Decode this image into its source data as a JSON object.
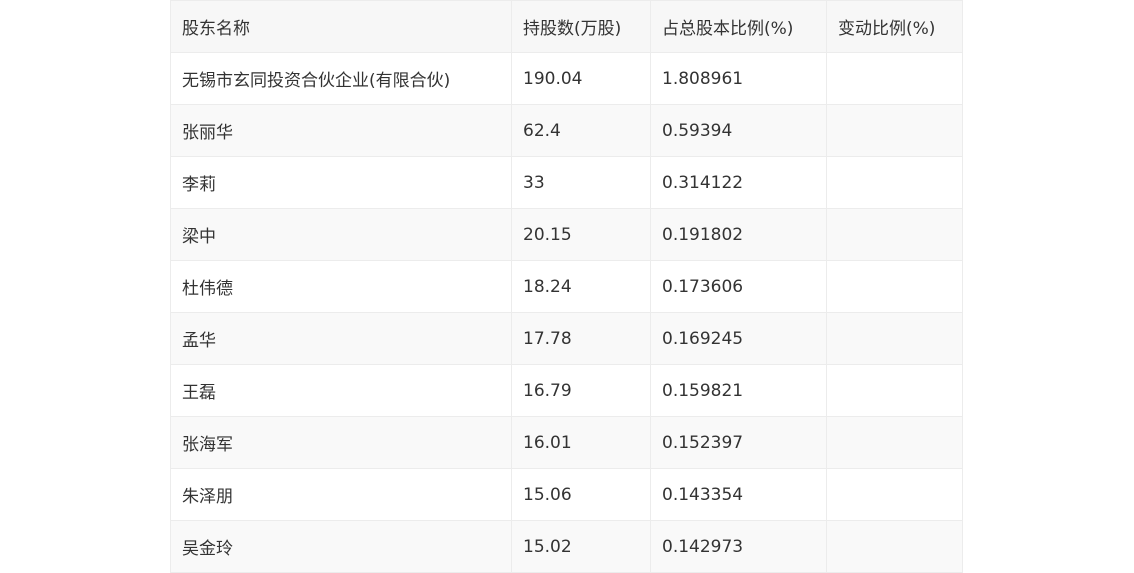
{
  "table": {
    "headers": [
      "股东名称",
      "持股数(万股)",
      "占总股本比例(%)",
      "变动比例(%)"
    ],
    "rows": [
      [
        "无锡市玄同投资合伙企业(有限合伙)",
        "190.04",
        "1.808961",
        ""
      ],
      [
        "张丽华",
        "62.4",
        "0.59394",
        ""
      ],
      [
        "李莉",
        "33",
        "0.314122",
        ""
      ],
      [
        "梁中",
        "20.15",
        "0.191802",
        ""
      ],
      [
        "杜伟德",
        "18.24",
        "0.173606",
        ""
      ],
      [
        "孟华",
        "17.78",
        "0.169245",
        ""
      ],
      [
        "王磊",
        "16.79",
        "0.159821",
        ""
      ],
      [
        "张海军",
        "16.01",
        "0.152397",
        ""
      ],
      [
        "朱泽朋",
        "15.06",
        "0.143354",
        ""
      ],
      [
        "吴金玲",
        "15.02",
        "0.142973",
        ""
      ]
    ]
  }
}
